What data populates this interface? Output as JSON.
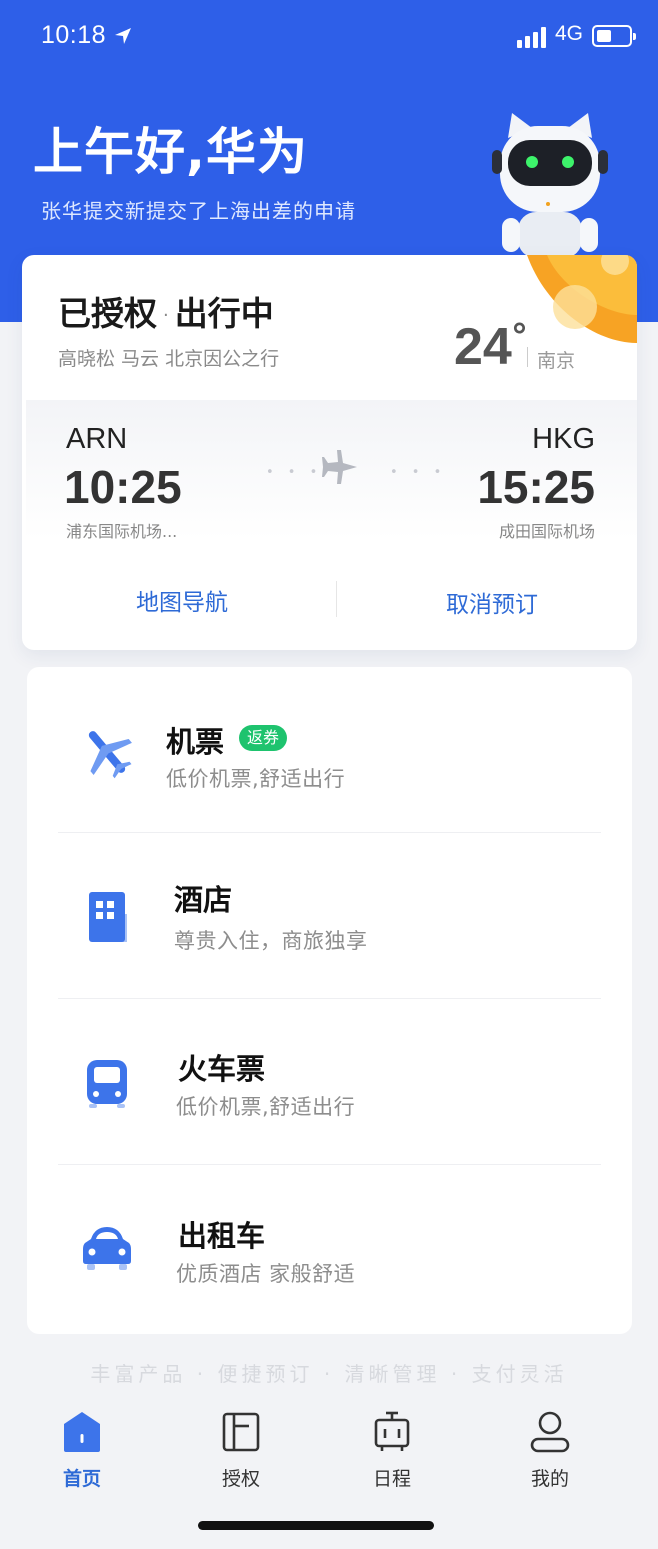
{
  "status_bar": {
    "time": "10:18",
    "network": "4G",
    "icons": [
      "location-arrow-icon",
      "signal-icon",
      "battery-icon"
    ]
  },
  "header": {
    "greeting": "上午好,华为",
    "subtitle": "张华提交新提交了上海出差的申请",
    "background_color": "#2e5fe8"
  },
  "trip": {
    "status_main": "已授权",
    "status_dot": "·",
    "status_secondary": "出行中",
    "people": "高晓松 马云 北京因公之行",
    "temperature": "24",
    "degree_symbol": "°",
    "city": "南京",
    "departure": {
      "code": "ARN",
      "time": "10:25",
      "airport": "浦东国际机场..."
    },
    "arrival": {
      "code": "HKG",
      "time": "15:25",
      "airport": "成田国际机场"
    },
    "dots": "• • •",
    "actions": {
      "navigate": "地图导航",
      "cancel": "取消预订"
    }
  },
  "services": [
    {
      "title": "机票",
      "badge": "返券",
      "desc": "低价机票,舒适出行",
      "icon": "plane-icon"
    },
    {
      "title": "酒店",
      "desc": "尊贵入住，商旅独享",
      "icon": "hotel-icon"
    },
    {
      "title": "火车票",
      "desc": "低价机票,舒适出行",
      "icon": "train-icon"
    },
    {
      "title": "出租车",
      "desc": "优质酒店 家般舒适",
      "icon": "taxi-icon"
    }
  ],
  "slogan": "丰富产品 · 便捷预订 · 清晰管理 · 支付灵活",
  "tabbar": [
    {
      "label": "首页",
      "icon": "home-icon",
      "active": true
    },
    {
      "label": "授权",
      "icon": "authorize-icon",
      "active": false
    },
    {
      "label": "日程",
      "icon": "schedule-icon",
      "active": false
    },
    {
      "label": "我的",
      "icon": "profile-icon",
      "active": false
    }
  ],
  "colors": {
    "accent": "#2e6ad6",
    "badge": "#1ec36e",
    "sun": "#f7a324"
  }
}
